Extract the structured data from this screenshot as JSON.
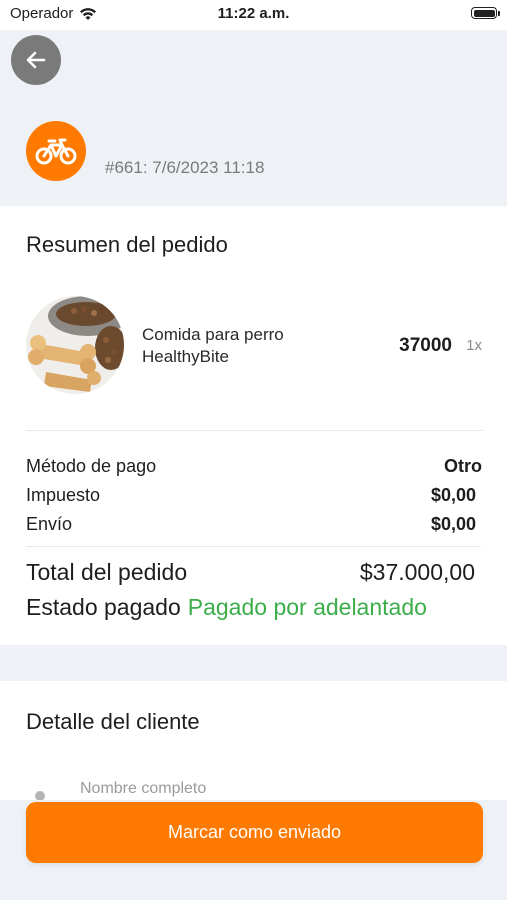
{
  "status_bar": {
    "carrier": "Operador",
    "time": "11:22 a.m."
  },
  "header": {
    "back_icon": "arrow-left-icon",
    "order_icon": "bicycle-icon",
    "order_ref": "#661: 7/6/2023 11:18"
  },
  "summary": {
    "title": "Resumen del pedido",
    "product": {
      "image": "dog-food-bone-image",
      "name_line1": "Comida para perro",
      "name_line2": "HealthyBite",
      "price": "37000",
      "qty": "1x"
    },
    "rows": [
      {
        "label": "Método de pago",
        "value": "Otro"
      },
      {
        "label": "Impuesto",
        "value": "$0,00"
      },
      {
        "label": "Envío",
        "value": "$0,00"
      }
    ],
    "total_label": "Total del pedido",
    "total_value": "$37.000,00",
    "paid_label": "Estado pagado",
    "paid_value": "Pagado por adelantado"
  },
  "customer": {
    "title": "Detalle del cliente",
    "full_name_label": "Nombre completo"
  },
  "actions": {
    "mark_shipped": "Marcar como enviado"
  },
  "colors": {
    "accent": "#FF7A00",
    "paid": "#3BAE4A",
    "background": "#EEF2F6"
  }
}
